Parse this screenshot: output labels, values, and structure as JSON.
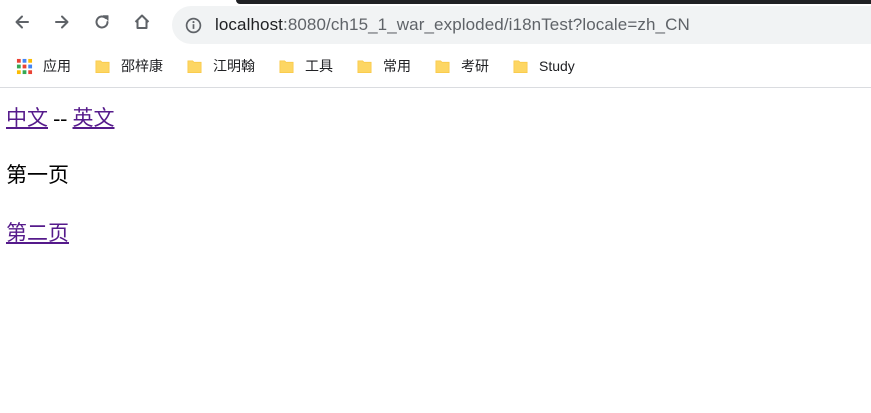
{
  "browser": {
    "url_host": "localhost",
    "url_rest": ":8080/ch15_1_war_exploded/i18nTest?locale=zh_CN",
    "icons": {
      "back": "arrow-left-icon",
      "forward": "arrow-right-icon",
      "reload": "reload-icon",
      "home": "home-icon",
      "info": "info-icon"
    }
  },
  "bookmarks": [
    {
      "label": "应用",
      "icon": "apps-grid-icon"
    },
    {
      "label": "邵梓康",
      "icon": "folder-icon"
    },
    {
      "label": "江明翰",
      "icon": "folder-icon"
    },
    {
      "label": "工具",
      "icon": "folder-icon"
    },
    {
      "label": "常用",
      "icon": "folder-icon"
    },
    {
      "label": "考研",
      "icon": "folder-icon"
    },
    {
      "label": "Study",
      "icon": "folder-icon"
    }
  ],
  "page": {
    "link_chinese": "中文",
    "separator": "--",
    "link_english": "英文",
    "page_label": "第一页",
    "link_page_two": "第二页"
  },
  "colors": {
    "visited_link": "#551a8b",
    "omnibox_bg": "#f1f3f4",
    "folder": "#fdd663"
  }
}
